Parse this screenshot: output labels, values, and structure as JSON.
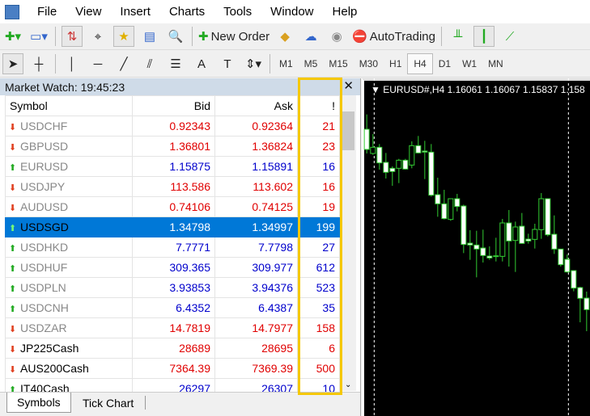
{
  "menu": [
    "File",
    "View",
    "Insert",
    "Charts",
    "Tools",
    "Window",
    "Help"
  ],
  "toolbar": {
    "new_order": "New Order",
    "autotrading": "AutoTrading"
  },
  "timeframes": [
    "M1",
    "M5",
    "M15",
    "M30",
    "H1",
    "H4",
    "D1",
    "W1",
    "MN"
  ],
  "active_timeframe": "H4",
  "market_watch": {
    "title": "Market Watch: 19:45:23",
    "columns": [
      "Symbol",
      "Bid",
      "Ask",
      "!"
    ],
    "rows": [
      {
        "symbol": "USDCHF",
        "bid": "0.92343",
        "ask": "0.92364",
        "spread": "21",
        "dir": "down",
        "muted": true,
        "color": "#e00000"
      },
      {
        "symbol": "GBPUSD",
        "bid": "1.36801",
        "ask": "1.36824",
        "spread": "23",
        "dir": "down",
        "muted": true,
        "color": "#e00000"
      },
      {
        "symbol": "EURUSD",
        "bid": "1.15875",
        "ask": "1.15891",
        "spread": "16",
        "dir": "up",
        "muted": true,
        "color": "#0000cc"
      },
      {
        "symbol": "USDJPY",
        "bid": "113.586",
        "ask": "113.602",
        "spread": "16",
        "dir": "down",
        "muted": true,
        "color": "#e00000"
      },
      {
        "symbol": "AUDUSD",
        "bid": "0.74106",
        "ask": "0.74125",
        "spread": "19",
        "dir": "down",
        "muted": true,
        "color": "#e00000"
      },
      {
        "symbol": "USDSGD",
        "bid": "1.34798",
        "ask": "1.34997",
        "spread": "199",
        "dir": "up",
        "muted": false,
        "selected": true,
        "color": "#ffffff"
      },
      {
        "symbol": "USDHKD",
        "bid": "7.7771",
        "ask": "7.7798",
        "spread": "27",
        "dir": "up",
        "muted": true,
        "color": "#0000cc"
      },
      {
        "symbol": "USDHUF",
        "bid": "309.365",
        "ask": "309.977",
        "spread": "612",
        "dir": "up",
        "muted": true,
        "color": "#0000cc"
      },
      {
        "symbol": "USDPLN",
        "bid": "3.93853",
        "ask": "3.94376",
        "spread": "523",
        "dir": "up",
        "muted": true,
        "color": "#0000cc"
      },
      {
        "symbol": "USDCNH",
        "bid": "6.4352",
        "ask": "6.4387",
        "spread": "35",
        "dir": "up",
        "muted": true,
        "color": "#0000cc"
      },
      {
        "symbol": "USDZAR",
        "bid": "14.7819",
        "ask": "14.7977",
        "spread": "158",
        "dir": "down",
        "muted": true,
        "color": "#e00000"
      },
      {
        "symbol": "JP225Cash",
        "bid": "28689",
        "ask": "28695",
        "spread": "6",
        "dir": "down",
        "muted": false,
        "color": "#e00000"
      },
      {
        "symbol": "AUS200Cash",
        "bid": "7364.39",
        "ask": "7369.39",
        "spread": "500",
        "dir": "down",
        "muted": false,
        "color": "#e00000"
      },
      {
        "symbol": "IT40Cash",
        "bid": "26297",
        "ask": "26307",
        "spread": "10",
        "dir": "up",
        "muted": false,
        "color": "#0000cc"
      }
    ],
    "tabs": [
      "Symbols",
      "Tick Chart"
    ]
  },
  "chart": {
    "label": "EURUSD#,H4  1.16061 1.16067 1.15837 1.158",
    "candle_color": "#32cd32"
  },
  "colors": {
    "highlight": "#f5c800",
    "selection": "#0078d7"
  }
}
